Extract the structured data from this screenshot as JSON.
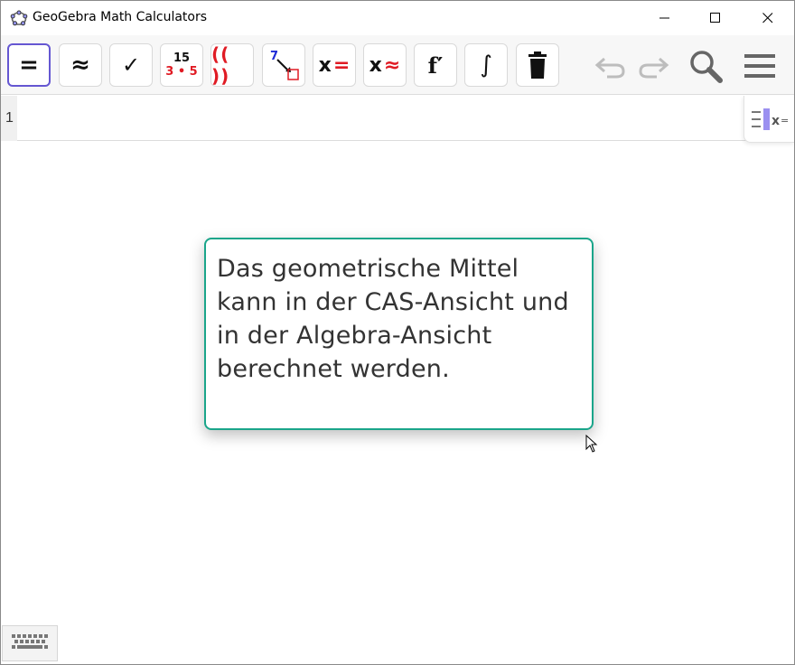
{
  "window": {
    "title": "GeoGebra Math Calculators",
    "controls": [
      "minimize",
      "maximize",
      "close"
    ]
  },
  "toolbar": {
    "tools": [
      {
        "name": "evaluate",
        "label": "=",
        "active": true
      },
      {
        "name": "numeric",
        "label": "≈"
      },
      {
        "name": "check",
        "label": "✓"
      },
      {
        "name": "factor",
        "label_top": "15",
        "label_bottom": "3 • 5"
      },
      {
        "name": "expand",
        "label": "(( ))"
      },
      {
        "name": "substitute",
        "label": "7"
      },
      {
        "name": "solve",
        "label_x": "x",
        "label_op": "="
      },
      {
        "name": "nsolve",
        "label_x": "x",
        "label_op": "≈"
      },
      {
        "name": "derivative",
        "label": "f′"
      },
      {
        "name": "integral",
        "label": "∫"
      },
      {
        "name": "delete",
        "label": "trash"
      }
    ],
    "right_icons": [
      "undo-icon",
      "redo-icon",
      "search-icon",
      "menu-icon"
    ]
  },
  "algebra": {
    "row_number": "1",
    "input_value": ""
  },
  "tooltip": {
    "text": "Das geometrische Mittel kann in der CAS-Ansicht und in der Algebra-Ansicht berechnet werden."
  },
  "colors": {
    "accent": "#6557d2",
    "tooltip_border": "#1aa58a",
    "red": "#e01b24",
    "blue": "#1f2bd6"
  }
}
